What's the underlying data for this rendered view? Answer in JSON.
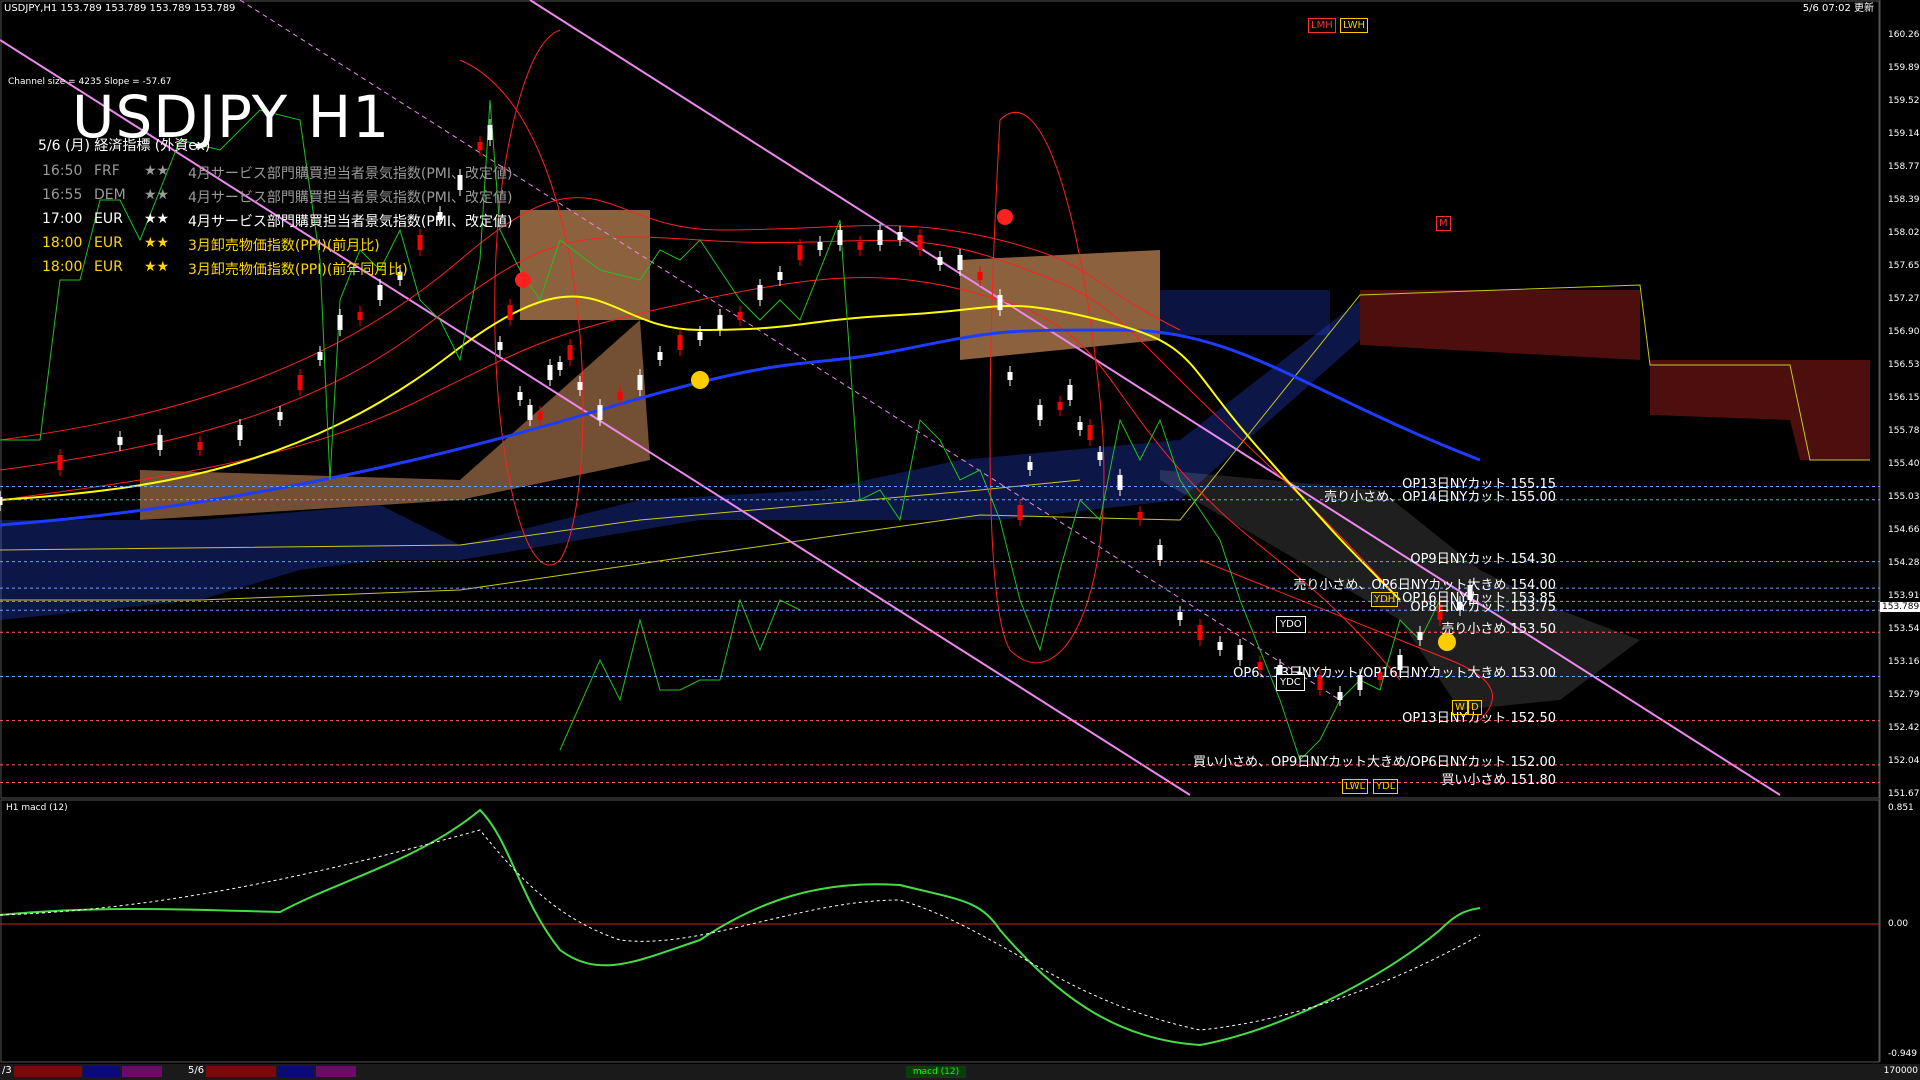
{
  "header": {
    "symbol_line": "USDJPY,H1  153.789 153.789 153.789 153.789",
    "server_time": "5/6 07:02 更新",
    "channel_info": "Channel size = 4235 Slope = -57.67",
    "big_title": "USDJPY H1"
  },
  "calendar": {
    "heading": "5/6 (月) 経済指標 (外資ex)",
    "rows": [
      {
        "time": "16:50",
        "currency": "FRF",
        "stars": "★★",
        "title": "4月サービス部門購買担当者景気指数(PMI、改定値)",
        "color": "#9a9a9a"
      },
      {
        "time": "16:55",
        "currency": "DEM",
        "stars": "★★",
        "title": "4月サービス部門購買担当者景気指数(PMI、改定値)",
        "color": "#9a9a9a"
      },
      {
        "time": "17:00",
        "currency": "EUR",
        "stars": "★★",
        "title": "4月サービス部門購買担当者景気指数(PMI、改定値)",
        "color": "#ffffff"
      },
      {
        "time": "18:00",
        "currency": "EUR",
        "stars": "★★",
        "title": "3月卸売物価指数(PPI)(前月比)",
        "color": "#ffd700"
      },
      {
        "time": "18:00",
        "currency": "EUR",
        "stars": "★★",
        "title": "3月卸売物価指数(PPI)(前年同月比)",
        "color": "#ffd700"
      }
    ]
  },
  "price_axis": {
    "ticks": [
      "160.260",
      "159.890",
      "159.520",
      "159.140",
      "158.770",
      "158.390",
      "158.020",
      "157.650",
      "157.270",
      "156.900",
      "156.530",
      "156.150",
      "155.780",
      "155.400",
      "155.030",
      "154.660",
      "154.280",
      "153.910",
      "153.540",
      "153.160",
      "152.790",
      "152.420",
      "152.040",
      "151.670"
    ],
    "current_price": "153.789",
    "range": [
      151.67,
      160.26
    ]
  },
  "levels": [
    {
      "text": "OP13日NYカット 155.15",
      "price": 155.15
    },
    {
      "text": "売り小さめ、OP14日NYカット 155.00",
      "price": 155.0
    },
    {
      "text": "OP9日NYカット 154.30",
      "price": 154.3
    },
    {
      "text": "売り小さめ、OP6日NYカット大きめ 154.00",
      "price": 154.0
    },
    {
      "text": "OP16日NYカット 153.85",
      "price": 153.85
    },
    {
      "text": "OP8日NYカット 153.75",
      "price": 153.75
    },
    {
      "text": "売り小さめ 153.50",
      "price": 153.5
    },
    {
      "text": "OP6、13日NYカット/OP16日NYカット大きめ 153.00",
      "price": 153.0
    },
    {
      "text": "OP13日NYカット 152.50",
      "price": 152.5
    },
    {
      "text": "買い小さめ、OP9日NYカット大きめ/OP6日NYカット 152.00",
      "price": 152.0
    },
    {
      "text": "買い小さめ 151.80",
      "price": 151.8
    }
  ],
  "markers": {
    "ydo": "YDO",
    "ydc": "YDC",
    "ydh": "YDH",
    "ydl": "YDL",
    "lvl": "LWL",
    "lmh": "LMH",
    "lwh": "LWH",
    "m": "M",
    "w": "W",
    "d": "D"
  },
  "macd_pane": {
    "label": "H1  macd (12)",
    "ticks": [
      "0.851",
      "0.00",
      "-0.949"
    ]
  },
  "bottom_bar": {
    "left_text": "/3",
    "date_text": "5/6",
    "macd_tab": "macd (12)",
    "right_text": "170000"
  },
  "colors": {
    "bull": "#ffffff",
    "bear": "#ff0000",
    "ma_yellow": "#ffff00",
    "ma_blue": "#1e3cff",
    "bollinger": "#ff2020",
    "green": "#20c020",
    "channel": "#ee88ee",
    "cloud_orange": "#ffb070",
    "cloud_blue": "#2a50ff",
    "macd_main_up": "#44dd44",
    "macd_main_down": "#ff88aa"
  }
}
